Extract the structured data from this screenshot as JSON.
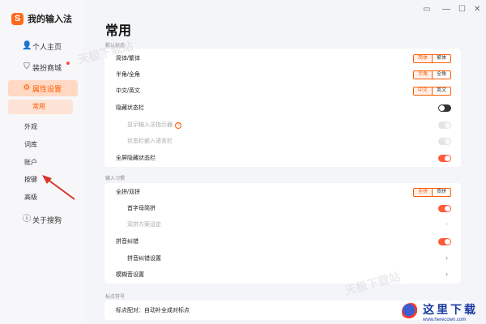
{
  "app": {
    "title": "我的输入法",
    "logo_letter": "S"
  },
  "sidebar": {
    "items": [
      {
        "label": "个人主页",
        "icon": "person-icon"
      },
      {
        "label": "装扮商城",
        "icon": "shirt-icon"
      },
      {
        "label": "属性设置",
        "icon": "settings-icon"
      }
    ],
    "sub_items": [
      "常用",
      "外观",
      "词库",
      "账户",
      "按键",
      "高级"
    ],
    "about": {
      "label": "关于搜狗",
      "icon": "info-icon"
    }
  },
  "page": {
    "title": "常用"
  },
  "sections": [
    {
      "label": "默认状态"
    },
    {
      "label": "输入习惯"
    },
    {
      "label": "标点符号"
    }
  ],
  "defaults": {
    "jianfan": {
      "label": "简体/繁体",
      "options": [
        "简体",
        "繁体"
      ],
      "selected": "简体"
    },
    "banquan": {
      "label": "半角/全角",
      "options": [
        "半角",
        "全角"
      ],
      "selected": "半角"
    },
    "zhongying": {
      "label": "中文/英文",
      "options": [
        "中文",
        "英文"
      ],
      "selected": "中文"
    },
    "hide_status": {
      "label": "隐藏状态栏",
      "value": "off"
    },
    "show_indicator": {
      "label": "显示输入法指示器",
      "value": "disabled"
    },
    "embed_lang": {
      "label": "状态栏嵌入语言栏",
      "value": "disabled"
    },
    "fullscreen_hide": {
      "label": "全屏隐藏状态栏",
      "value": "on"
    }
  },
  "habits": {
    "quanshuang": {
      "label": "全拼/双拼",
      "options": [
        "全拼",
        "双拼"
      ],
      "selected": "全拼"
    },
    "shouzimu": {
      "label": "首字母简拼",
      "value": "on"
    },
    "shuangpin_scheme": {
      "label": "双拼方案设定"
    },
    "pinyin_correct": {
      "label": "拼音纠错",
      "value": "on"
    },
    "pinyin_correct_settings": {
      "label": "拼音纠错设置"
    },
    "fuzzy": {
      "label": "模糊音设置"
    }
  },
  "punctuation": {
    "pairing": {
      "label": "标点配对：自动补全成对标点"
    }
  },
  "watermark": {
    "cn": "这里下载",
    "url": "www.herecown.com",
    "faint": "天极下载站"
  },
  "colors": {
    "accent": "#ff5a00",
    "toggle_on": "#ff5a3a",
    "sidebar_bg": "#f7f7fa",
    "page_bg": "#f4f5f9"
  }
}
